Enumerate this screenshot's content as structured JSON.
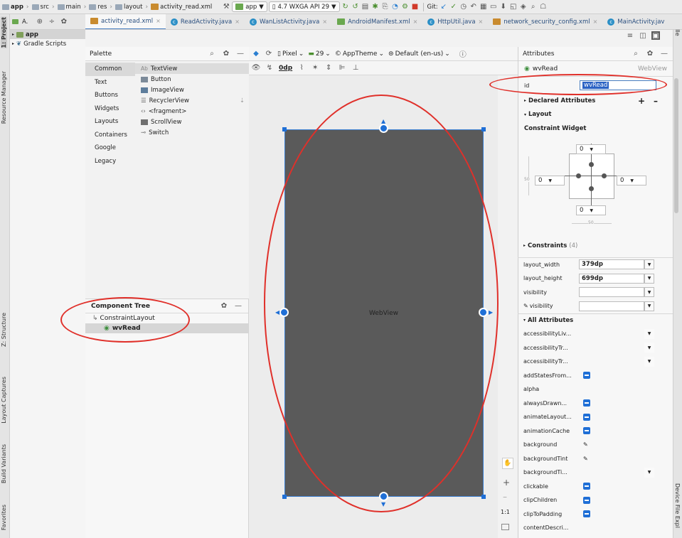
{
  "toolbar": {
    "breadcrumbs": [
      "app",
      "src",
      "main",
      "res",
      "layout",
      "activity_read.xml"
    ],
    "run_config": "app",
    "device": "4.7 WXGA API 29",
    "git_label": "Git:"
  },
  "project_panel": {
    "header_label": "A.  ",
    "items": [
      {
        "label": "app"
      },
      {
        "label": "Gradle Scripts"
      }
    ],
    "strip_labels": [
      "1: Project",
      "Resource Manager",
      "Z: Structure",
      "Layout Captures",
      "Build Variants",
      "Favorites"
    ]
  },
  "right_strip": {
    "labels": [
      "Gradle",
      "Device File Expl"
    ]
  },
  "tabs": [
    {
      "label": "activity_read.xml",
      "type": "xml",
      "active": true
    },
    {
      "label": "ReadActivity.java",
      "type": "class",
      "active": false
    },
    {
      "label": "WanListActivity.java",
      "type": "class",
      "active": false
    },
    {
      "label": "AndroidManifest.xml",
      "type": "android",
      "active": false
    },
    {
      "label": "HttpUtil.java",
      "type": "class",
      "active": false
    },
    {
      "label": "network_security_config.xml",
      "type": "xml",
      "active": false
    },
    {
      "label": "MainActivity.jav",
      "type": "class",
      "active": false
    }
  ],
  "palette": {
    "title": "Palette",
    "categories": [
      "Common",
      "Text",
      "Buttons",
      "Widgets",
      "Layouts",
      "Containers",
      "Google",
      "Legacy"
    ],
    "selected_category": "Common",
    "items": [
      "TextView",
      "Button",
      "ImageView",
      "RecyclerView",
      "<fragment>",
      "ScrollView",
      "Switch"
    ],
    "item_prefixes": {
      "textview": "Ab"
    }
  },
  "component_tree": {
    "title": "Component Tree",
    "root": "ConstraintLayout",
    "child": "wvRead"
  },
  "design_toolbar": {
    "device": "Pixel",
    "api": "29",
    "theme": "AppTheme",
    "locale": "Default (en-us)",
    "margin": "0dp"
  },
  "canvas": {
    "widget_label": "WebView",
    "zoom_label": "1:1"
  },
  "attributes": {
    "title": "Attributes",
    "component_name": "wvRead",
    "component_type": "WebView",
    "id_label": "id",
    "id_value": "wvRead",
    "declared_label": "Declared Attributes",
    "layout_label": "Layout",
    "constraint_widget_label": "Constraint Widget",
    "margins": {
      "top": "0",
      "left": "0",
      "right": "0",
      "bottom": "0"
    },
    "bias": "50",
    "constraints_label": "Constraints",
    "constraints_count": "(4)",
    "layout_width_label": "layout_width",
    "layout_width": "379dp",
    "layout_height_label": "layout_height",
    "layout_height": "699dp",
    "visibility_label": "visibility",
    "tools_visibility_label": "visibility",
    "all_attrs_label": "All Attributes",
    "all_attrs": [
      "accessibilityLiv...",
      "accessibilityTr...",
      "accessibilityTr...",
      "addStatesFrom...",
      "alpha",
      "alwaysDrawn...",
      "animateLayout...",
      "animationCache",
      "background",
      "backgroundTint",
      "backgroundTi...",
      "clickable",
      "clipChildren",
      "clipToPadding",
      "contentDescri..."
    ]
  },
  "annotation_color": "#e0302a",
  "accent_color": "#1f6fd6"
}
